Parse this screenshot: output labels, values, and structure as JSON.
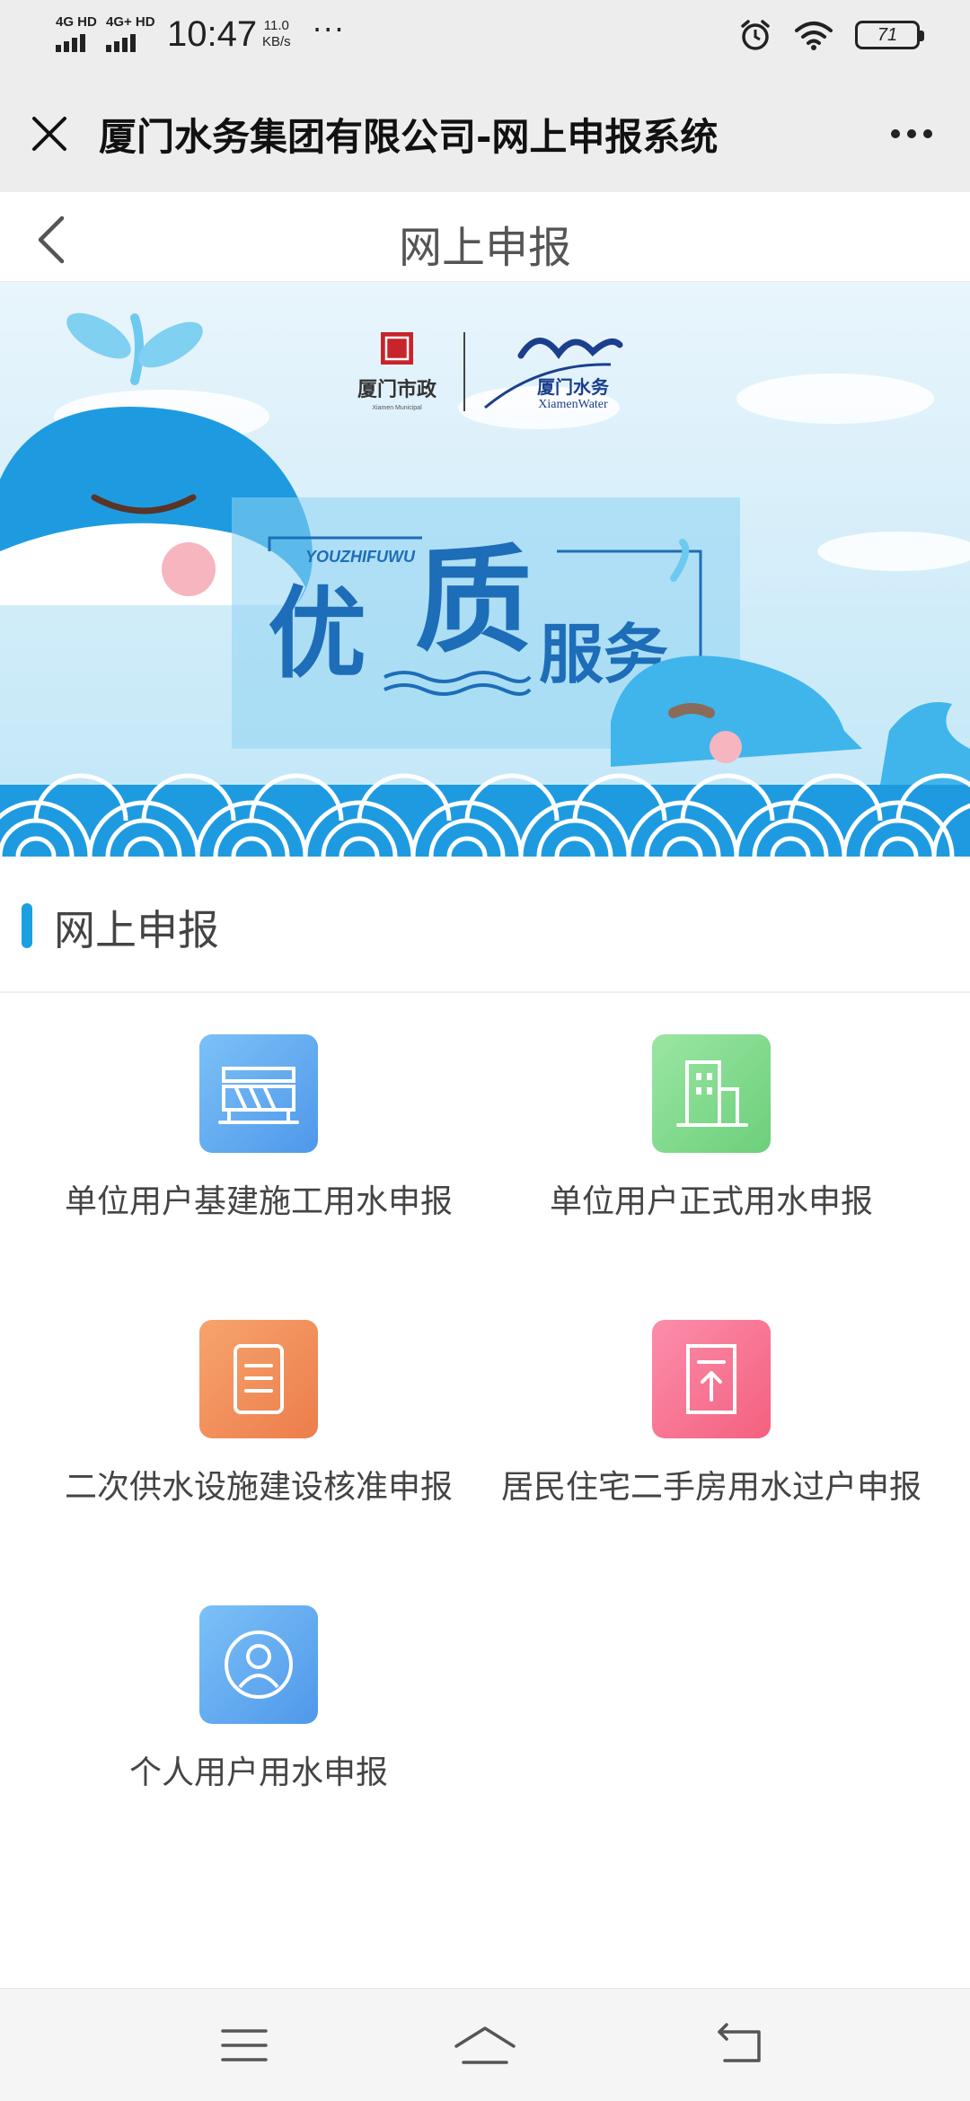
{
  "status_bar": {
    "signal1": "4G HD",
    "signal2": "4G+ HD",
    "time": "10:47",
    "speed_value": "11.0",
    "speed_unit": "KB/s",
    "more": "···",
    "battery": "71"
  },
  "app_bar": {
    "title": "厦门水务集团有限公司-网上申报系统"
  },
  "page": {
    "title": "网上申报"
  },
  "banner": {
    "logo_left_cn": "厦门市政",
    "logo_left_en": "Xiamen Municipal",
    "logo_right_cn": "厦门水务",
    "logo_right_en": "XiamenWater",
    "pinyin": "YOUZHIFUWU",
    "slogan_1": "优",
    "slogan_2": "质",
    "slogan_3": "服务"
  },
  "section": {
    "title": "网上申报"
  },
  "services": [
    {
      "label": "单位用户基建施工用水申报",
      "icon": "construction-barrier-icon",
      "color": "#5aa9f0"
    },
    {
      "label": "单位用户正式用水申报",
      "icon": "building-icon",
      "color": "#7fd88a"
    },
    {
      "label": "二次供水设施建设核准申报",
      "icon": "document-list-icon",
      "color": "#f08a55"
    },
    {
      "label": "居民住宅二手房用水过户申报",
      "icon": "document-upload-icon",
      "color": "#f56b8b"
    },
    {
      "label": "个人用户用水申报",
      "icon": "person-icon",
      "color": "#5aa9f0"
    }
  ],
  "colors": {
    "accent": "#1aa0e0",
    "chrome": "#ededed"
  }
}
